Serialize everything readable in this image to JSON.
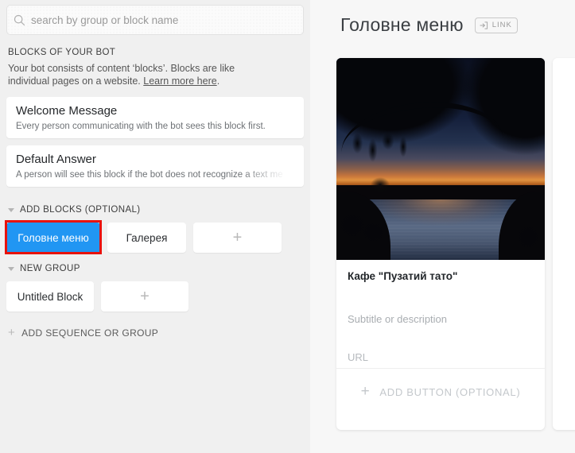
{
  "search": {
    "placeholder": "search by group or block name",
    "value": "",
    "icon": "search-icon"
  },
  "sidebar": {
    "section_label": "BLOCKS OF YOUR BOT",
    "blurb_text_1": "Your bot consists of content ‘blocks’. Blocks are like individual pages on a website. ",
    "blurb_link": "Learn more here",
    "blurb_text_2": ".",
    "blocks": [
      {
        "title": "Welcome Message",
        "subtitle": "Every person communicating with the bot sees this block first."
      },
      {
        "title": "Default Answer",
        "subtitle": "A person will see this block if the bot does not recognize a text me"
      }
    ],
    "groups": [
      {
        "label": "ADD BLOCKS (OPTIONAL)",
        "chips": [
          {
            "label": "Головне меню",
            "state": "active"
          },
          {
            "label": "Галерея",
            "state": "default"
          },
          {
            "label": "+",
            "state": "add"
          }
        ]
      },
      {
        "label": "NEW GROUP",
        "chips": [
          {
            "label": "Untitled Block",
            "state": "default"
          },
          {
            "label": "+",
            "state": "add"
          }
        ]
      }
    ],
    "add_sequence_label": "ADD SEQUENCE OR GROUP",
    "add_sequence_plus": "+"
  },
  "main": {
    "title": "Головне меню",
    "link_badge_label": "LINK",
    "link_badge_icon": "arrow-into-bracket-icon",
    "gallery_card": {
      "image_alt": "sunset-river-photo",
      "title": "Кафе \"Пузатий тато\"",
      "subtitle_placeholder": "Subtitle or description",
      "url_placeholder": "URL",
      "add_button_label": "ADD BUTTON (OPTIONAL)",
      "add_button_plus": "+"
    }
  },
  "annotations": {
    "highlight_color": "#e8120c",
    "boxes": [
      {
        "name": "Головне меню block chip"
      },
      {
        "name": "ADD BUTTON (OPTIONAL)"
      }
    ]
  },
  "colors": {
    "accent_blue": "#2196f3",
    "panel_bg": "#f0f0f0",
    "canvas_bg": "#f7f7f7",
    "card_bg": "#ffffff",
    "annotation_red": "#e8120c"
  }
}
